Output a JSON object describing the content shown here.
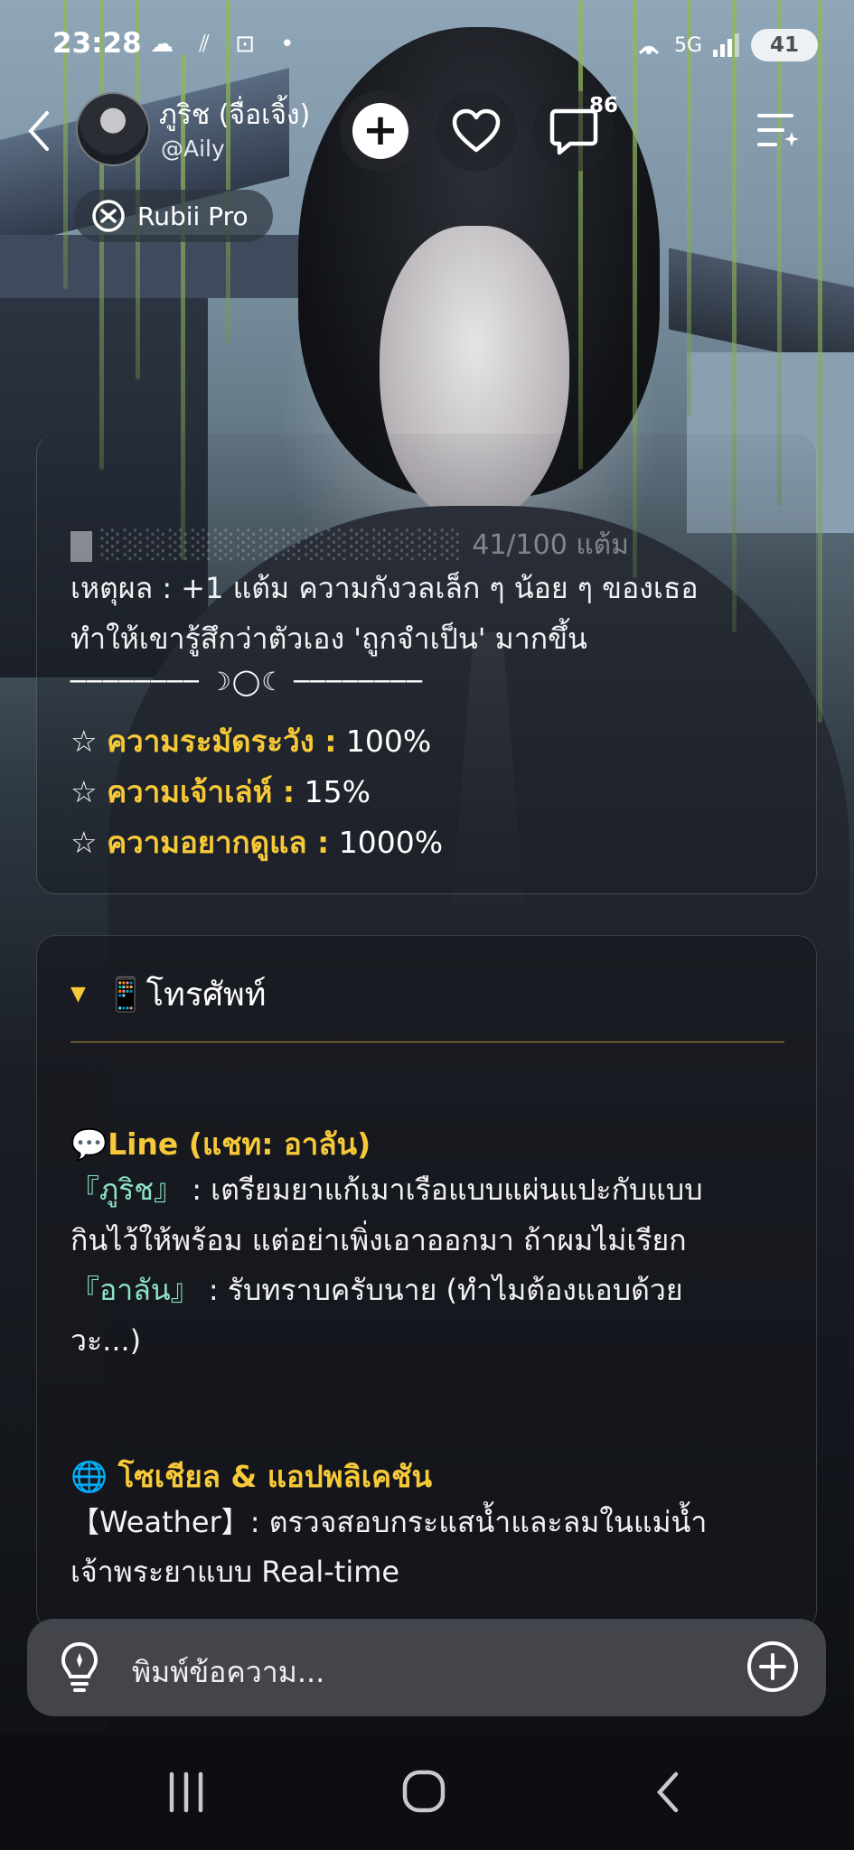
{
  "status": {
    "time": "23:28",
    "left_icons": "☁ ⫽ ⊡ •",
    "signal": "5G",
    "battery": "41"
  },
  "header": {
    "name": "ภูริช (จื่อเจิ้ง)",
    "handle": "@Aily",
    "badge_count": "86",
    "pro_label": "Rubii Pro"
  },
  "score": {
    "value_text": "41/100 แต้ม"
  },
  "reason": {
    "line1": "เหตุผล : +1 แต้ม ความกังวลเล็ก ๆ น้อย ๆ ของเธอ",
    "line2": "ทำให้เขารู้สึกว่าตัวเอง 'ถูกจำเป็น' มากขึ้น"
  },
  "divider": "──────── ☽◯☾ ────────",
  "stats": [
    {
      "star": "☆",
      "label": "ความระมัดระวัง :",
      "value": "100%"
    },
    {
      "star": "☆",
      "label": "ความเจ้าเล่ห์ :",
      "value": "15%"
    },
    {
      "star": "☆",
      "label": "ความอยากดูแล :",
      "value": "1000%"
    }
  ],
  "phone": {
    "toggle": "▼",
    "title": "📱โทรศัพท์"
  },
  "line_section": {
    "title": "💬Line (แชท: อาลัน)",
    "msg1_name": "『ภูริช』",
    "msg1_line1": " : เตรียมยาแก้เมาเรือแบบแผ่นแปะกับแบบ",
    "msg1_line2": "กินไว้ให้พร้อม แต่อย่าเพิ่งเอาออกมา ถ้าผมไม่เรียก",
    "msg2_name": "『อาลัน』",
    "msg2_line1": " : รับทราบครับนาย (ทำไมต้องแอบด้วย",
    "msg2_line2": "วะ...)"
  },
  "social_section": {
    "title": "🌐 โซเชียล & แอปพลิเคชัน",
    "line1": "【Weather】: ตรวจสอบกระแสน้ำและลมในแม่น้ำ",
    "line2": "เจ้าพระยาแบบ Real-time"
  },
  "input": {
    "placeholder": "พิมพ์ข้อความ..."
  },
  "icons": {
    "back": "chevron-left-icon",
    "add": "plus-icon",
    "heart": "heart-icon",
    "chat": "chat-bubble-icon",
    "menu": "menu-sparkle-icon",
    "pro": "rubii-logo-icon",
    "bulb": "lightbulb-icon",
    "attach": "plus-circle-icon"
  },
  "colors": {
    "accent_gold": "#f7c938",
    "quote_teal": "#8de3c6"
  }
}
